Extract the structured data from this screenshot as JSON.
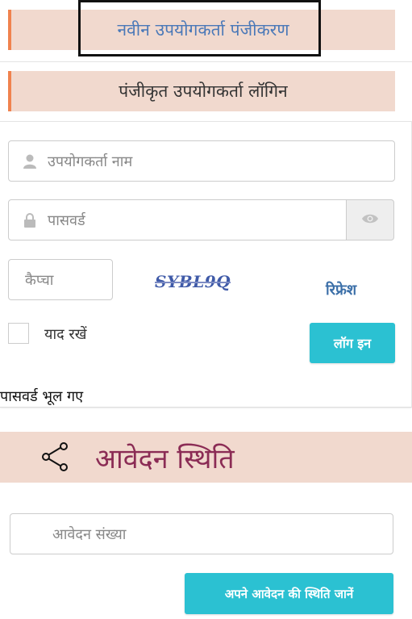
{
  "tabs": {
    "register_label": "नवीन उपयोगकर्ता पंजीकरण",
    "login_label": "पंजीकृत उपयोगकर्ता लॉगिन"
  },
  "login_form": {
    "username_placeholder": "उपयोगकर्ता नाम",
    "password_placeholder": "पासवर्ड",
    "captcha_placeholder": "कैप्चा",
    "captcha_text": "SYBL9Q",
    "refresh_label": "रिफ्रेश",
    "remember_label": "याद रखें",
    "login_button": "लॉग इन",
    "forgot_password": "पासवर्ड भूल गए"
  },
  "application_status": {
    "title": "आवेदन स्थिति",
    "number_placeholder": "आवेदन संख्या",
    "submit_button": "अपने आवेदन की स्थिति जानें"
  },
  "colors": {
    "tab_bg": "#f1d9ce",
    "tab_accent": "#f0824e",
    "button_bg": "#2bc1d2",
    "status_title": "#8b2c55"
  }
}
